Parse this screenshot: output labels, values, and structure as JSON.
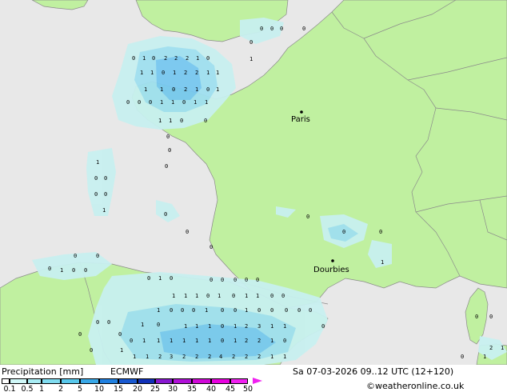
{
  "title": "Precipitation [mm]",
  "model": "ECMWF",
  "valid_time": "Sa 07-03-2026 09..12 UTC (12+120)",
  "credit": "©weatheronline.co.uk",
  "colors": {
    "sea": "#e8e8e8",
    "land": "#c0f0a0",
    "border": "#8a8a8a",
    "precip_light": "#c8f0f0",
    "precip_mid": "#a0e0f0",
    "precip_high": "#78c8f0"
  },
  "legend": {
    "ticks": [
      "0.1",
      "0.5",
      "1",
      "2",
      "5",
      "10",
      "15",
      "20",
      "25",
      "30",
      "35",
      "40",
      "45",
      "50"
    ],
    "colors": [
      "#ffffff",
      "#d0f8f8",
      "#a8ecf4",
      "#80dcf0",
      "#58c8ec",
      "#38a8e8",
      "#2080e0",
      "#1858d0",
      "#1030b8",
      "#8818d0",
      "#b010d8",
      "#d008d8",
      "#e800e0",
      "#f020f0"
    ]
  },
  "cities": [
    {
      "name": "Paris"
    },
    {
      "name": "Dourbies"
    }
  ]
}
